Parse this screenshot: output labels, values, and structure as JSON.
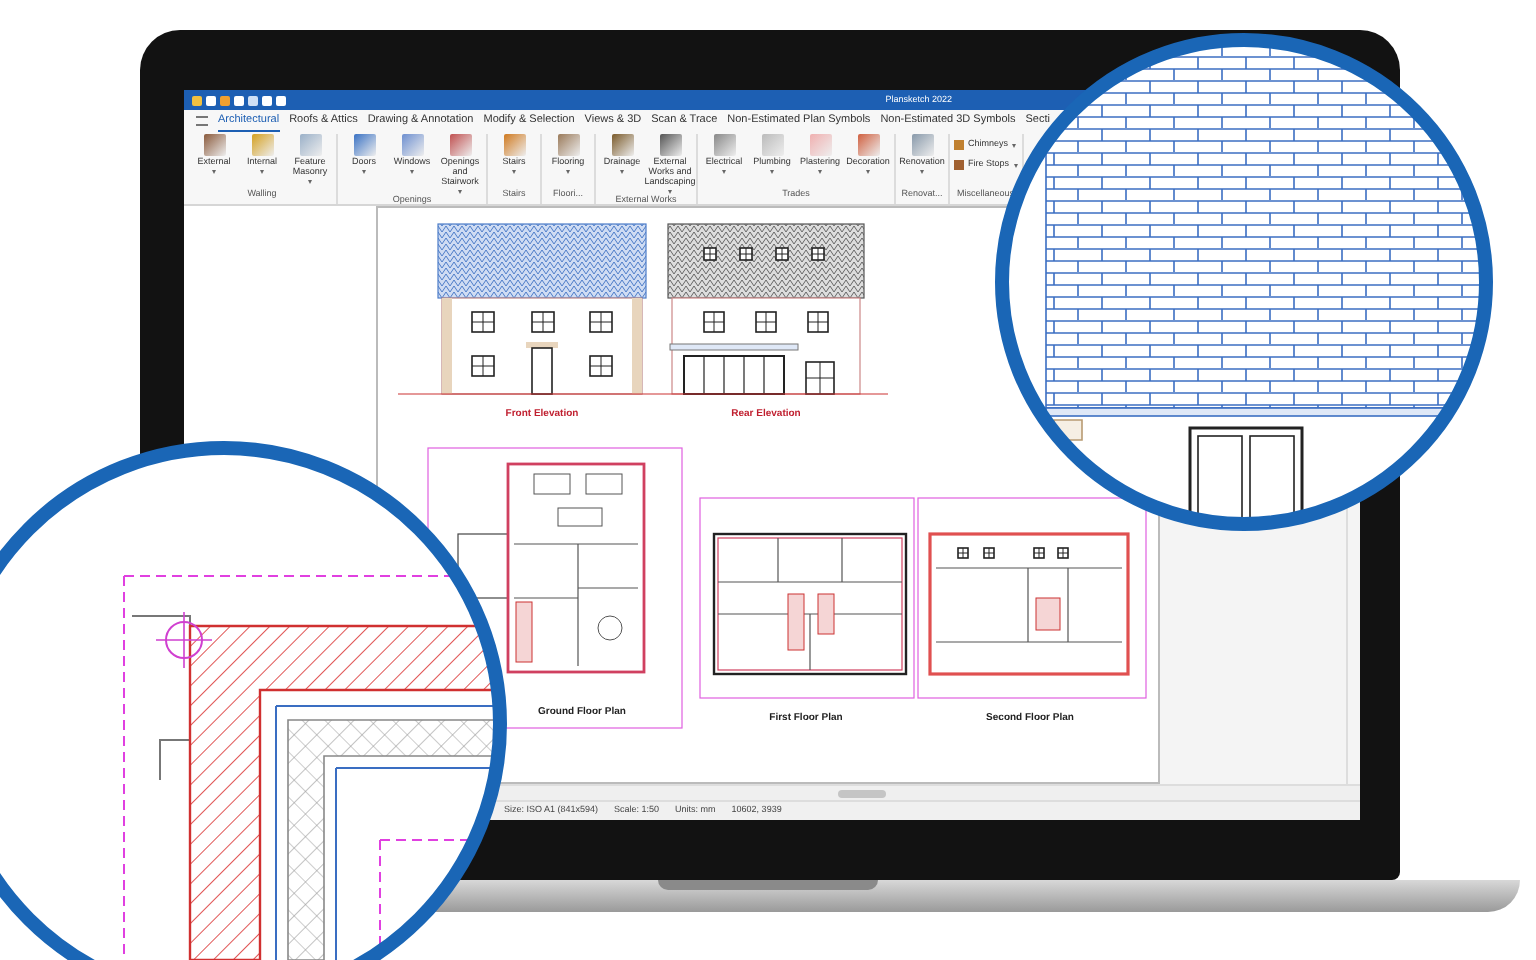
{
  "app": {
    "title": "Plansketch 2022"
  },
  "ribbon_tabs": [
    {
      "label": "Architectural",
      "selected": true
    },
    {
      "label": "Roofs & Attics",
      "selected": false
    },
    {
      "label": "Drawing & Annotation",
      "selected": false
    },
    {
      "label": "Modify & Selection",
      "selected": false
    },
    {
      "label": "Views & 3D",
      "selected": false
    },
    {
      "label": "Scan & Trace",
      "selected": false
    },
    {
      "label": "Non-Estimated Plan Symbols",
      "selected": false
    },
    {
      "label": "Non-Estimated 3D Symbols",
      "selected": false
    },
    {
      "label": "Secti",
      "selected": false
    }
  ],
  "ribbon_groups": [
    {
      "label": "Walling",
      "tools": [
        {
          "kind": "large",
          "label": "External",
          "dropdown": true
        },
        {
          "kind": "large",
          "label": "Internal",
          "dropdown": true
        },
        {
          "kind": "large",
          "label": "Feature Masonry",
          "dropdown": true
        }
      ]
    },
    {
      "label": "Openings",
      "tools": [
        {
          "kind": "large",
          "label": "Doors",
          "dropdown": true
        },
        {
          "kind": "large",
          "label": "Windows",
          "dropdown": true
        },
        {
          "kind": "large",
          "label": "Openings and Stairwork",
          "dropdown": true
        }
      ]
    },
    {
      "label": "Stairs",
      "tools": [
        {
          "kind": "large",
          "label": "Stairs",
          "dropdown": true
        }
      ]
    },
    {
      "label": "Floori...",
      "tools": [
        {
          "kind": "large",
          "label": "Flooring",
          "dropdown": true
        }
      ]
    },
    {
      "label": "External Works",
      "tools": [
        {
          "kind": "large",
          "label": "Drainage",
          "dropdown": true
        },
        {
          "kind": "large",
          "label": "External Works and Landscaping",
          "dropdown": true
        }
      ]
    },
    {
      "label": "Trades",
      "tools": [
        {
          "kind": "large",
          "label": "Electrical",
          "dropdown": true
        },
        {
          "kind": "large",
          "label": "Plumbing",
          "dropdown": true
        },
        {
          "kind": "large",
          "label": "Plastering",
          "dropdown": true
        },
        {
          "kind": "large",
          "label": "Decoration",
          "dropdown": true
        }
      ]
    },
    {
      "label": "Renovat...",
      "tools": [
        {
          "kind": "large",
          "label": "Renovation",
          "dropdown": true
        }
      ]
    },
    {
      "label": "Miscellaneous",
      "tools": [
        {
          "kind": "small",
          "label": "Chimneys",
          "dropdown": true
        },
        {
          "kind": "small",
          "label": "Fire Stops",
          "dropdown": true
        }
      ]
    }
  ],
  "sheet": {
    "drawings": [
      {
        "kind": "front_elevation",
        "caption": "Front Elevation"
      },
      {
        "kind": "rear_elevation",
        "caption": "Rear Elevation"
      },
      {
        "kind": "ground_plan",
        "caption": "Ground Floor Plan"
      },
      {
        "kind": "first_plan",
        "caption": "First Floor Plan"
      },
      {
        "kind": "second_plan",
        "caption": "Second Floor Plan"
      }
    ]
  },
  "status_bar": [
    "Size: ISO A1 (841x594)",
    "Scale: 1:50",
    "Units: mm",
    "10602, 3939"
  ]
}
